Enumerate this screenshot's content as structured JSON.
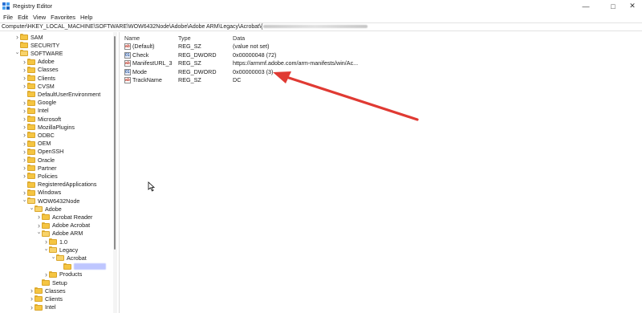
{
  "window": {
    "title": "Registry Editor"
  },
  "menu": [
    "File",
    "Edit",
    "View",
    "Favorites",
    "Help"
  ],
  "address": "Computer\\HKEY_LOCAL_MACHINE\\SOFTWARE\\WOW6432Node\\Adobe\\Adobe ARM\\Legacy\\Acrobat\\{",
  "tree": [
    {
      "label": "SAM"
    },
    {
      "label": "SECURITY"
    },
    {
      "label": "SOFTWARE"
    },
    {
      "label": "Adobe"
    },
    {
      "label": "Classes"
    },
    {
      "label": "Clients"
    },
    {
      "label": "CVSM"
    },
    {
      "label": "DefaultUserEnvironment"
    },
    {
      "label": "Google"
    },
    {
      "label": "Intel"
    },
    {
      "label": "Microsoft"
    },
    {
      "label": "MozillaPlugins"
    },
    {
      "label": "ODBC"
    },
    {
      "label": "OEM"
    },
    {
      "label": "OpenSSH"
    },
    {
      "label": "Oracle"
    },
    {
      "label": "Partner"
    },
    {
      "label": "Policies"
    },
    {
      "label": "RegisteredApplications"
    },
    {
      "label": "Windows"
    },
    {
      "label": "WOW6432Node"
    },
    {
      "label": "Adobe"
    },
    {
      "label": "Acrobat Reader"
    },
    {
      "label": "Adobe Acrobat"
    },
    {
      "label": "Adobe ARM"
    },
    {
      "label": "1.0"
    },
    {
      "label": "Legacy"
    },
    {
      "label": "Acrobat"
    },
    {
      "label": ""
    },
    {
      "label": "Products"
    },
    {
      "label": "Setup"
    },
    {
      "label": "Classes"
    },
    {
      "label": "Clients"
    },
    {
      "label": "Intel"
    }
  ],
  "columns": {
    "name": "Name",
    "type": "Type",
    "data": "Data"
  },
  "values": [
    {
      "name": "(Default)",
      "type": "REG_SZ",
      "data": "(value not set)",
      "icon": "string-value-icon"
    },
    {
      "name": "Check",
      "type": "REG_DWORD",
      "data": "0x00000048 (72)",
      "icon": "dword-value-icon"
    },
    {
      "name": "ManifestURL_3",
      "type": "REG_SZ",
      "data": "https://armmf.adobe.com/arm-manifests/win/Ac...",
      "icon": "string-value-icon"
    },
    {
      "name": "Mode",
      "type": "REG_DWORD",
      "data": "0x00000003 (3)",
      "icon": "dword-value-icon"
    },
    {
      "name": "TrackName",
      "type": "REG_SZ",
      "data": "DC",
      "icon": "string-value-icon"
    }
  ],
  "colors": {
    "arrow": "#e03a33",
    "folder": "#f5c542",
    "selection": "#aeb8ff"
  }
}
